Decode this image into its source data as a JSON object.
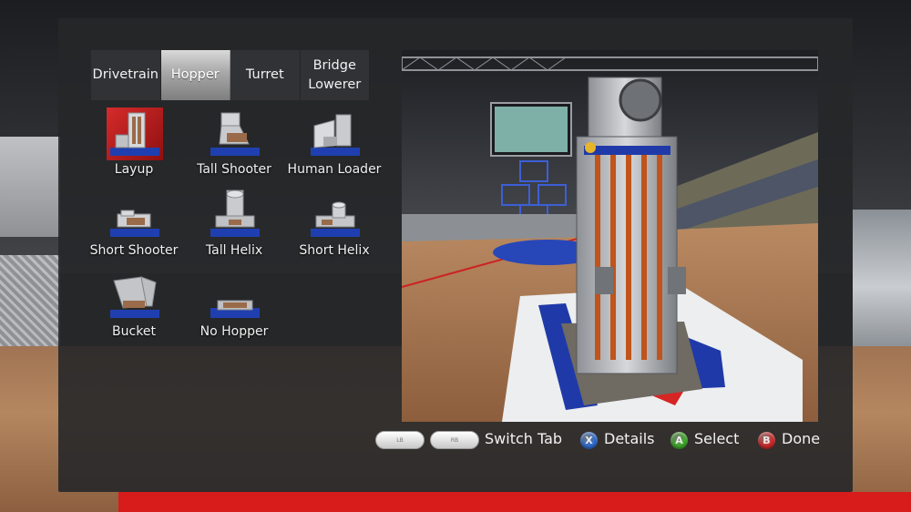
{
  "tabs": [
    {
      "label": "Drivetrain",
      "active": false
    },
    {
      "label": "Hopper",
      "active": true
    },
    {
      "label": "Turret",
      "active": false
    },
    {
      "label": "Bridge\nLowerer",
      "active": false
    }
  ],
  "parts": [
    {
      "label": "Layup",
      "icon": "layup-hopper-icon",
      "selected": true
    },
    {
      "label": "Tall Shooter",
      "icon": "tall-shooter-hopper-icon",
      "selected": false
    },
    {
      "label": "Human Loader",
      "icon": "human-loader-hopper-icon",
      "selected": false
    },
    {
      "label": "Short Shooter",
      "icon": "short-shooter-hopper-icon",
      "selected": false
    },
    {
      "label": "Tall Helix",
      "icon": "tall-helix-hopper-icon",
      "selected": false
    },
    {
      "label": "Short Helix",
      "icon": "short-helix-hopper-icon",
      "selected": false
    },
    {
      "label": "Bucket",
      "icon": "bucket-hopper-icon",
      "selected": false
    },
    {
      "label": "No Hopper",
      "icon": "no-hopper-icon",
      "selected": false
    }
  ],
  "footer": {
    "lb_label": "LB",
    "rb_label": "RB",
    "switch_tab": "Switch Tab",
    "x_glyph": "X",
    "details": "Details",
    "a_glyph": "A",
    "select": "Select",
    "b_glyph": "B",
    "done": "Done"
  },
  "colors": {
    "x_button": "#2f6fd6",
    "a_button": "#3fae2a",
    "b_button": "#d42a2a",
    "selected_tile": "#c81e1e",
    "active_tab": "#bdbdbd"
  }
}
